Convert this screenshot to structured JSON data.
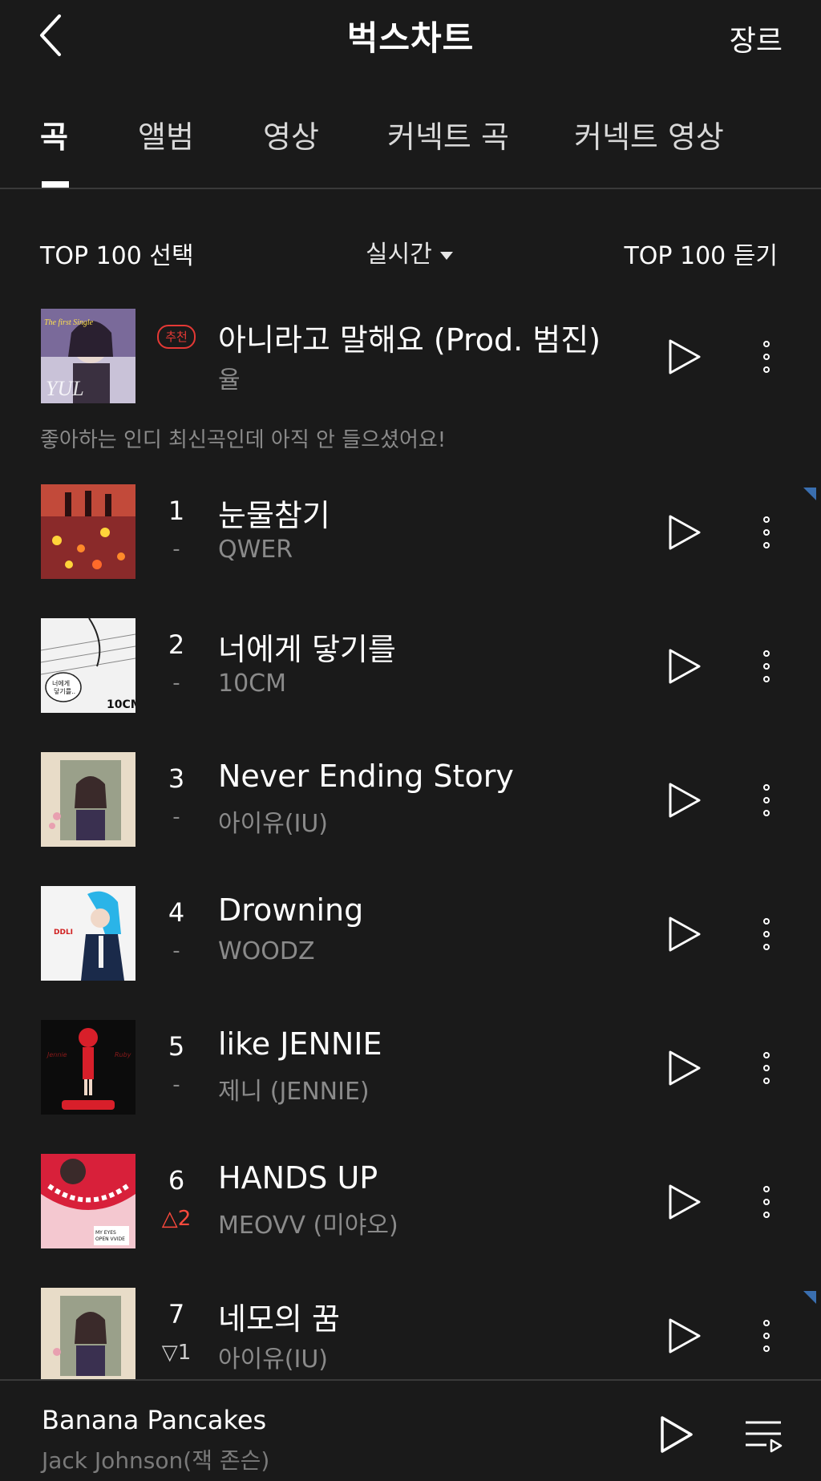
{
  "header": {
    "title": "벅스차트",
    "genre_label": "장르"
  },
  "tabs": [
    {
      "label": "곡",
      "active": true
    },
    {
      "label": "앨범"
    },
    {
      "label": "영상"
    },
    {
      "label": "커넥트 곡"
    },
    {
      "label": "커넥트 영상"
    }
  ],
  "controls": {
    "select_label": "TOP 100 선택",
    "period_label": "실시간",
    "listen_label": "TOP 100 듣기"
  },
  "recommend": {
    "badge": "추천",
    "song": "아니라고 말해요 (Prod. 범진)",
    "artist": "율",
    "message": "좋아하는 인디 최신곡인데 아직 안 들으셨어요!"
  },
  "chart": [
    {
      "rank": "1",
      "change": "-",
      "song": "눈물참기",
      "artist": "QWER"
    },
    {
      "rank": "2",
      "change": "-",
      "song": "너에게 닿기를",
      "artist": "10CM"
    },
    {
      "rank": "3",
      "change": "-",
      "song": "Never Ending Story",
      "artist": "아이유(IU)"
    },
    {
      "rank": "4",
      "change": "-",
      "song": "Drowning",
      "artist": "WOODZ"
    },
    {
      "rank": "5",
      "change": "-",
      "song": "like JENNIE",
      "artist": "제니 (JENNIE)"
    },
    {
      "rank": "6",
      "change": "△2",
      "song": "HANDS UP",
      "artist": "MEOVV (미야오)"
    },
    {
      "rank": "7",
      "change": "▽1",
      "song": "네모의 꿈",
      "artist": "아이유(IU)"
    }
  ],
  "player": {
    "song": "Banana Pancakes",
    "artist": "Jack Johnson(잭 존슨)"
  },
  "colors": {
    "background": "#1a1a1a",
    "accent_red": "#ff4a3d",
    "muted": "#8a8a8a"
  }
}
